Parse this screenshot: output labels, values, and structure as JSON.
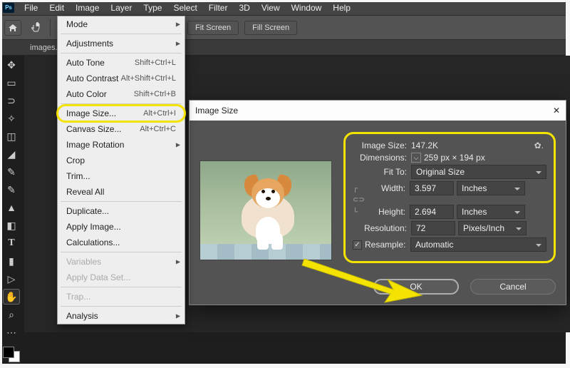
{
  "menubar": {
    "logo": "Ps",
    "items": [
      "File",
      "Edit",
      "Image",
      "Layer",
      "Type",
      "Select",
      "Filter",
      "3D",
      "View",
      "Window",
      "Help"
    ]
  },
  "optbar": {
    "fit_screen": "Fit Screen",
    "fill_screen": "Fill Screen"
  },
  "doc_tab": "images.",
  "image_menu": [
    {
      "type": "row",
      "label": "Mode",
      "submenu": true
    },
    {
      "type": "sep"
    },
    {
      "type": "row",
      "label": "Adjustments",
      "submenu": true
    },
    {
      "type": "sep"
    },
    {
      "type": "row",
      "label": "Auto Tone",
      "shortcut": "Shift+Ctrl+L"
    },
    {
      "type": "row",
      "label": "Auto Contrast",
      "shortcut": "Alt+Shift+Ctrl+L"
    },
    {
      "type": "row",
      "label": "Auto Color",
      "shortcut": "Shift+Ctrl+B"
    },
    {
      "type": "sep"
    },
    {
      "type": "row",
      "label": "Image Size...",
      "shortcut": "Alt+Ctrl+I",
      "highlight": true
    },
    {
      "type": "row",
      "label": "Canvas Size...",
      "shortcut": "Alt+Ctrl+C"
    },
    {
      "type": "row",
      "label": "Image Rotation",
      "submenu": true
    },
    {
      "type": "row",
      "label": "Crop"
    },
    {
      "type": "row",
      "label": "Trim..."
    },
    {
      "type": "row",
      "label": "Reveal All"
    },
    {
      "type": "sep"
    },
    {
      "type": "row",
      "label": "Duplicate..."
    },
    {
      "type": "row",
      "label": "Apply Image..."
    },
    {
      "type": "row",
      "label": "Calculations..."
    },
    {
      "type": "sep"
    },
    {
      "type": "row",
      "label": "Variables",
      "submenu": true,
      "disabled": true
    },
    {
      "type": "row",
      "label": "Apply Data Set...",
      "disabled": true
    },
    {
      "type": "sep"
    },
    {
      "type": "row",
      "label": "Trap...",
      "disabled": true
    },
    {
      "type": "sep"
    },
    {
      "type": "row",
      "label": "Analysis",
      "submenu": true
    }
  ],
  "dialog": {
    "title": "Image Size",
    "close": "✕",
    "image_size_label": "Image Size:",
    "image_size_value": "147.2K",
    "dimensions_label": "Dimensions:",
    "dimensions_value": "259 px  ×  194 px",
    "fit_to_label": "Fit To:",
    "fit_to_value": "Original Size",
    "width_label": "Width:",
    "width_value": "3.597",
    "width_unit": "Inches",
    "height_label": "Height:",
    "height_value": "2.694",
    "height_unit": "Inches",
    "resolution_label": "Resolution:",
    "resolution_value": "72",
    "resolution_unit": "Pixels/Inch",
    "resample_label": "Resample:",
    "resample_value": "Automatic",
    "resample_checked": true,
    "ok": "OK",
    "cancel": "Cancel"
  },
  "annotation": {
    "color": "#f4e300"
  }
}
